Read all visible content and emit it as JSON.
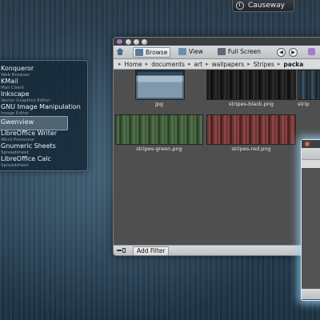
{
  "taskbar": {
    "active_task": "Causeway",
    "icon": "power-icon"
  },
  "launcher": {
    "items": [
      {
        "name": "Konqueror",
        "description": "Web Browser"
      },
      {
        "name": "KMail",
        "description": "Mail Client"
      },
      {
        "name": "Inkscape",
        "description": "Vector Graphics Editor"
      },
      {
        "name": "GNU Image Manipulation",
        "description": "Image Editor"
      },
      {
        "name": "Gwenview",
        "description": ""
      },
      {
        "name": "LibreOffice Writer",
        "description": "Word Processor"
      },
      {
        "name": "Gnumeric Sheets",
        "description": "Spreadsheet"
      },
      {
        "name": "LibreOffice Calc",
        "description": "Spreadsheet"
      }
    ],
    "selected_index": 4
  },
  "file_manager": {
    "toolbar": {
      "browse_label": "Browse",
      "view_label": "View",
      "fullscreen_label": "Full Screen"
    },
    "breadcrumb": [
      "Home",
      "documents",
      "art",
      "wallpapers",
      "Stripes",
      "packa"
    ],
    "files": [
      {
        "name": "jpg",
        "thumb_colors": [
          "#7f9aae",
          "#2f4a5f",
          "#a8bccb"
        ]
      },
      {
        "name": "stripes-black.png",
        "thumb_colors": [
          "#1a1a1a",
          "#2b2b2b",
          "#0f0f0f"
        ]
      },
      {
        "name": "strip",
        "thumb_colors": [
          "#2b3b45",
          "#1c2830",
          "#3a4f5c"
        ]
      },
      {
        "name": "stripes-green.png",
        "thumb_colors": [
          "#3d5a3a",
          "#516d49",
          "#2c4529"
        ]
      },
      {
        "name": "stripes-red.png",
        "thumb_colors": [
          "#6b3434",
          "#8a4444",
          "#4d2222"
        ]
      }
    ],
    "status": {
      "add_filter_label": "Add Filter"
    }
  },
  "colors": {
    "accent": "#4f6a89",
    "selection_glow": "#96d2f5",
    "window_bg": "#4f4f4f"
  }
}
